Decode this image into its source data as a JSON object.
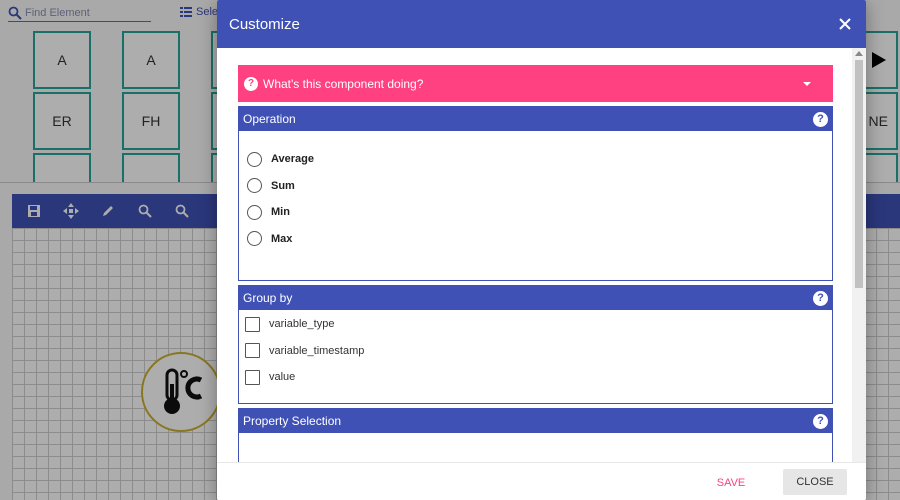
{
  "background": {
    "search_placeholder": "Find Element",
    "select_label": "Sele",
    "tiles": [
      "A",
      "A",
      "ER",
      "FH",
      "NE"
    ],
    "toolbar_icons": [
      "save-icon",
      "move-icon",
      "edit-icon",
      "zoom-out-icon",
      "zoom-in-icon"
    ],
    "node_icon": "thermometer-celsius-icon"
  },
  "dialog": {
    "title": "Customize",
    "help": {
      "label": "What's this component doing?"
    },
    "operation": {
      "title": "Operation",
      "options": [
        "Average",
        "Sum",
        "Min",
        "Max"
      ]
    },
    "group_by": {
      "title": "Group by",
      "options": [
        "variable_type",
        "variable_timestamp",
        "value"
      ]
    },
    "property_selection": {
      "title": "Property Selection"
    },
    "footer": {
      "save": "SAVE",
      "close": "CLOSE"
    }
  },
  "colors": {
    "primary": "#3f51b5",
    "accent": "#ff4081",
    "tile_border": "#26a69a"
  }
}
